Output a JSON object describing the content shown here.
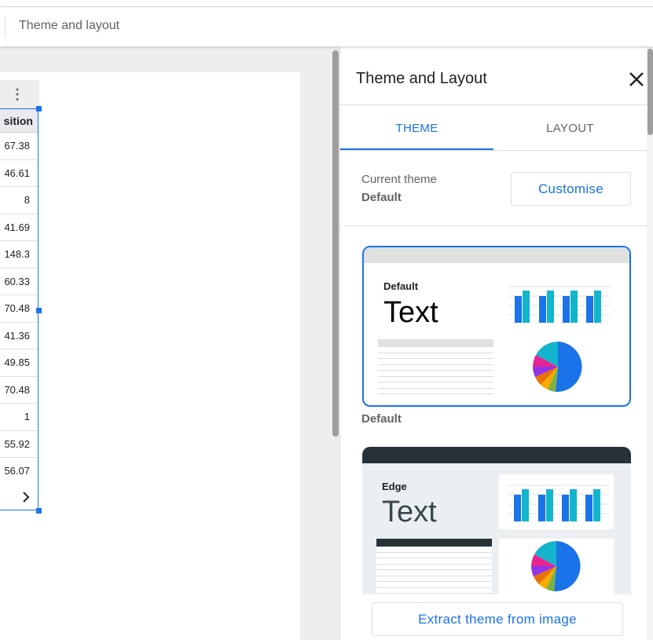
{
  "toolbar": {
    "title": "Theme and layout"
  },
  "table": {
    "header": "sition",
    "values": [
      "67.38",
      "46.61",
      "8",
      "41.69",
      "148.3",
      "60.33",
      "70.48",
      "41.36",
      "49.85",
      "70.48",
      "1",
      "55.92",
      "56.07"
    ],
    "next_icon": "chevron-right-icon",
    "menu_icon": "more-vert-icon"
  },
  "panel": {
    "title": "Theme and Layout",
    "close_icon": "close-icon",
    "tabs": [
      {
        "label": "THEME",
        "selected": true
      },
      {
        "label": "LAYOUT",
        "selected": false
      }
    ],
    "current_theme_label": "Current theme",
    "current_theme_value": "Default",
    "customise_label": "Customise",
    "themes": [
      {
        "name": "Default",
        "preview_text": "Text",
        "caption": "Default",
        "selected": true
      },
      {
        "name": "Edge",
        "preview_text": "Text"
      }
    ],
    "extract_label": "Extract theme from image"
  },
  "colors": {
    "accent": "#1a73e8",
    "chart_blue": "#1a73e8",
    "chart_teal": "#12b5cb",
    "pie": [
      "#1a73e8",
      "#12b5cb",
      "#e52592",
      "#f9ab00",
      "#e8710a",
      "#7cb342",
      "#9334e6"
    ],
    "edge_header": "#263238"
  }
}
